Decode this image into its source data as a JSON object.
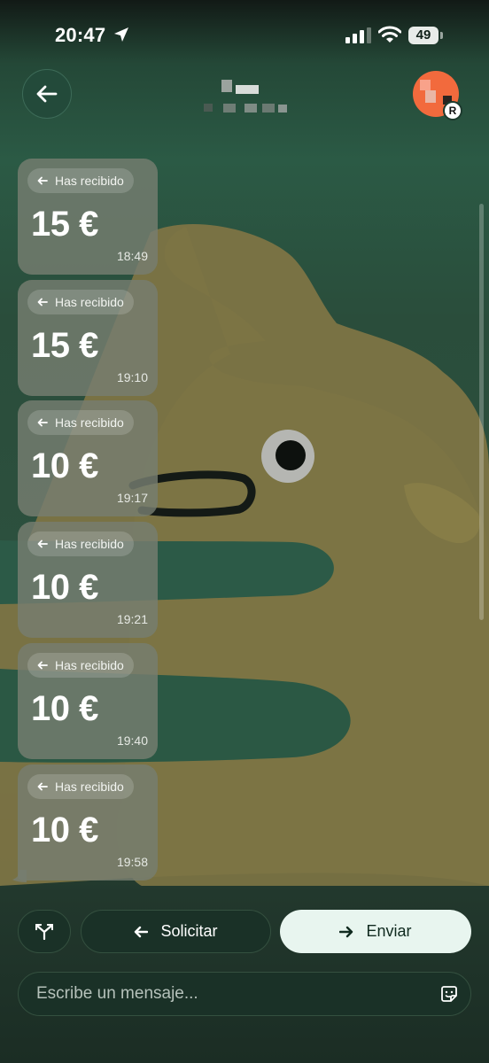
{
  "status_bar": {
    "time": "20:47",
    "battery": "49"
  },
  "transactions": [
    {
      "label": "Has recibido",
      "amount": "15 €",
      "time": "18:49"
    },
    {
      "label": "Has recibido",
      "amount": "15 €",
      "time": "19:10"
    },
    {
      "label": "Has recibido",
      "amount": "10 €",
      "time": "19:17"
    },
    {
      "label": "Has recibido",
      "amount": "10 €",
      "time": "19:21"
    },
    {
      "label": "Has recibido",
      "amount": "10 €",
      "time": "19:40"
    },
    {
      "label": "Has recibido",
      "amount": "10 €",
      "time": "19:58"
    }
  ],
  "actions": {
    "request_label": "Solicitar",
    "send_label": "Enviar"
  },
  "composer": {
    "placeholder": "Escribe un mensaje..."
  },
  "avatar_badge": "R",
  "icons": {
    "back": "arrow-left-icon",
    "split": "split-arrows-icon",
    "request": "arrow-left-icon",
    "send": "arrow-right-icon",
    "sticker": "sticker-icon",
    "location": "location-arrow-icon",
    "signal": "signal-icon",
    "wifi": "wifi-icon"
  },
  "colors": {
    "background": "#20382d",
    "bubble": "#767e70",
    "send_button": "#e8f5ef",
    "avatar": "#f26a3d"
  }
}
